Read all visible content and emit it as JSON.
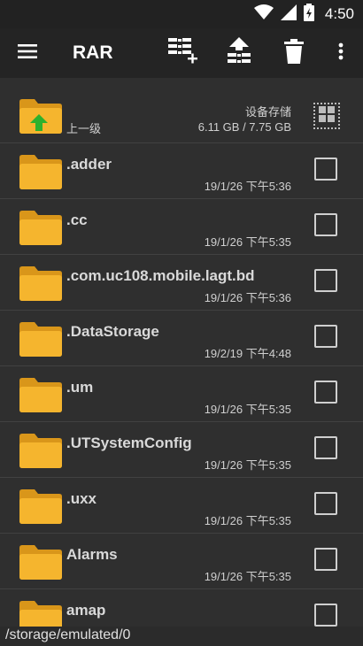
{
  "status": {
    "time": "4:50"
  },
  "app": {
    "title": "RAR",
    "icons": [
      "menu-icon",
      "add-to-archive-icon",
      "extract-icon",
      "delete-icon",
      "more-vert-icon"
    ]
  },
  "parent_row": {
    "label": "上一级",
    "storage_label": "设备存储",
    "storage_value": "6.11 GB / 7.75 GB"
  },
  "files": [
    {
      "name": ".adder",
      "date": "19/1/26 下午5:36"
    },
    {
      "name": ".cc",
      "date": "19/1/26 下午5:35"
    },
    {
      "name": ".com.uc108.mobile.lagt.bd",
      "date": "19/1/26 下午5:36"
    },
    {
      "name": ".DataStorage",
      "date": "19/2/19 下午4:48"
    },
    {
      "name": ".um",
      "date": "19/1/26 下午5:35"
    },
    {
      "name": ".UTSystemConfig",
      "date": "19/1/26 下午5:35"
    },
    {
      "name": ".uxx",
      "date": "19/1/26 下午5:35"
    },
    {
      "name": "Alarms",
      "date": "19/1/26 下午5:35"
    },
    {
      "name": "amap",
      "date": ""
    }
  ],
  "path": "/storage/emulated/0",
  "colors": {
    "folder": "#f5b52e",
    "folder_tab": "#d9961a",
    "up_arrow": "#2db12d",
    "bar": "#242424",
    "background": "#2f2f2f"
  }
}
